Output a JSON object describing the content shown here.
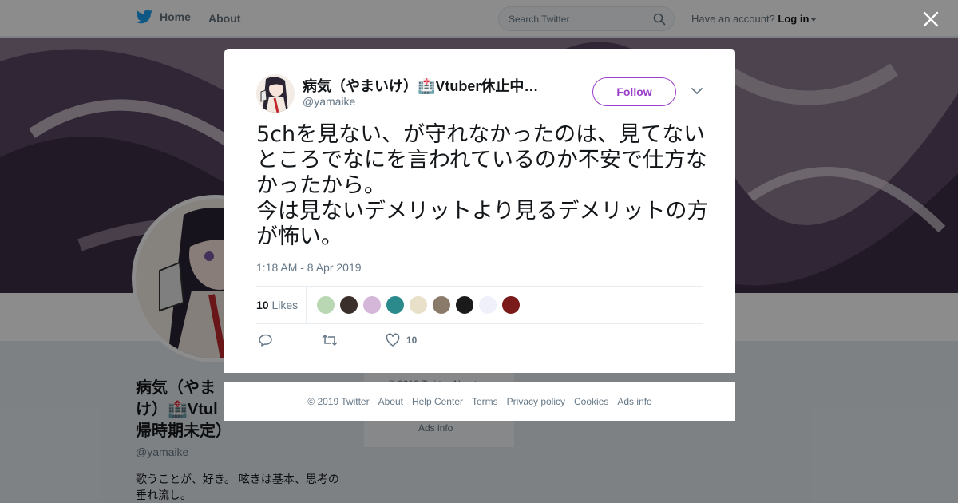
{
  "topnav": {
    "home_label": "Home",
    "about_label": "About",
    "search_placeholder": "Search Twitter",
    "account_prompt": "Have an account?",
    "login_label": "Log in"
  },
  "profile": {
    "name": "病気（やまいけ）🏥Vtuber休止中・復帰時期未定）",
    "name_visible_line1": "病気（やま",
    "name_visible_line2": "け）🏥Vtul",
    "name_visible_line3": "帰時期未定）",
    "handle": "@yamaike",
    "bio_line1": "歌うことが、好き。 呟きは基本、思考の",
    "bio_line2": "垂れ流し。",
    "side_card_copy": "© 2019 Twitter  About",
    "side_card_ads": "Ads info"
  },
  "tweet": {
    "author_name": "病気（やまいけ）🏥Vtuber休止中…",
    "author_handle": "@yamaike",
    "follow_label": "Follow",
    "text": "5chを見ない、が守れなかったのは、見てないところでなにを言われているのか不安で仕方なかったから。\n今は見ないデメリットより見るデメリットの方が怖い。",
    "timestamp": "1:18 AM - 8 Apr 2019",
    "likes_count": "10",
    "likes_label": "Likes",
    "like_action_count": "10"
  },
  "likers": [
    {
      "color": "#b9d7b3"
    },
    {
      "color": "#3a2f2a"
    },
    {
      "color": "#d5b7d9"
    },
    {
      "color": "#2a8a8c"
    },
    {
      "color": "#e8e0c8"
    },
    {
      "color": "#8a7a6a"
    },
    {
      "color": "#1a1a1a"
    },
    {
      "color": "#f0f0fa"
    },
    {
      "color": "#7a1a1a"
    }
  ],
  "footer": {
    "copyright": "© 2019 Twitter",
    "about": "About",
    "help": "Help Center",
    "terms": "Terms",
    "privacy": "Privacy policy",
    "cookies": "Cookies",
    "ads": "Ads info"
  },
  "colors": {
    "accent": "#9b3fc9",
    "twitter_blue": "#1da1f2",
    "muted_text": "#657786"
  }
}
